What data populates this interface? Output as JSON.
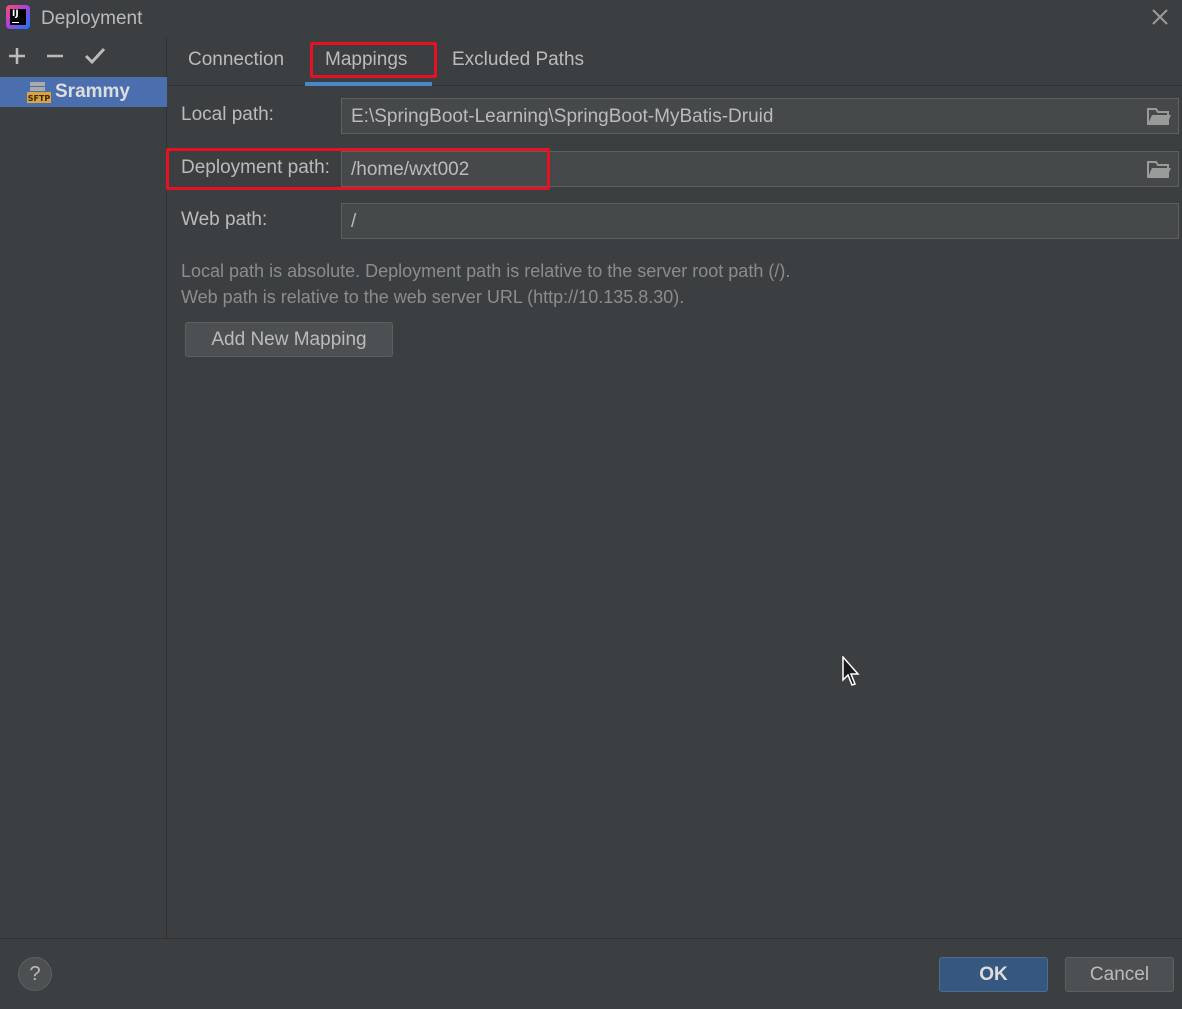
{
  "window": {
    "title": "Deployment",
    "app_icon_text": "IJ"
  },
  "sidebar": {
    "toolbar": {
      "add": "+",
      "remove": "−",
      "apply": "✔"
    },
    "servers": [
      {
        "name": "Srammy",
        "type": "SFTP",
        "selected": true
      }
    ]
  },
  "tabs": [
    {
      "label": "Connection",
      "active": false
    },
    {
      "label": "Mappings",
      "active": true
    },
    {
      "label": "Excluded Paths",
      "active": false
    }
  ],
  "mappings": {
    "local_path_label": "Local path:",
    "local_path_value": "E:\\SpringBoot-Learning\\SpringBoot-MyBatis-Druid",
    "deployment_path_label": "Deployment path:",
    "deployment_path_value": "/home/wxt002",
    "web_path_label": "Web path:",
    "web_path_value": "/",
    "hint_line1": "Local path is absolute. Deployment path is relative to the server root path (/).",
    "hint_line2": "Web path is relative to the web server URL (http://10.135.8.30).",
    "add_mapping_label": "Add New Mapping"
  },
  "footer": {
    "help_label": "?",
    "ok_label": "OK",
    "cancel_label": "Cancel"
  },
  "colors": {
    "background": "#3c3f41",
    "selection": "#4b6eaf",
    "tab_underline": "#4a88c7",
    "highlight_box": "#e81123",
    "ok_button": "#365880"
  },
  "icons": [
    "app-logo-icon",
    "close-icon",
    "add-icon",
    "remove-icon",
    "checkmark-icon",
    "sftp-server-icon",
    "folder-icon",
    "help-icon",
    "mouse-cursor-icon"
  ]
}
